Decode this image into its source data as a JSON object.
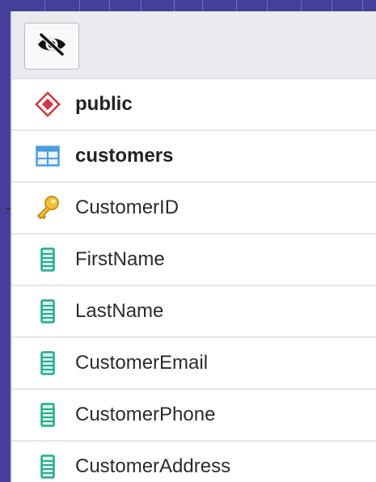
{
  "toolbar": {
    "visibility_toggle_icon": "eye-off-icon"
  },
  "tree": {
    "schema": {
      "label": "public",
      "icon": "schema-icon",
      "color": "#d6343f"
    },
    "table": {
      "label": "customers",
      "icon": "table-icon",
      "color": "#4a9ee0"
    },
    "columns": [
      {
        "label": "CustomerID",
        "icon": "key-icon",
        "color": "#e9b422"
      },
      {
        "label": "FirstName",
        "icon": "column-icon",
        "color": "#1fae8c"
      },
      {
        "label": "LastName",
        "icon": "column-icon",
        "color": "#1fae8c"
      },
      {
        "label": "CustomerEmail",
        "icon": "column-icon",
        "color": "#1fae8c"
      },
      {
        "label": "CustomerPhone",
        "icon": "column-icon",
        "color": "#1fae8c"
      },
      {
        "label": "CustomerAddress",
        "icon": "column-icon",
        "color": "#1fae8c"
      }
    ]
  }
}
